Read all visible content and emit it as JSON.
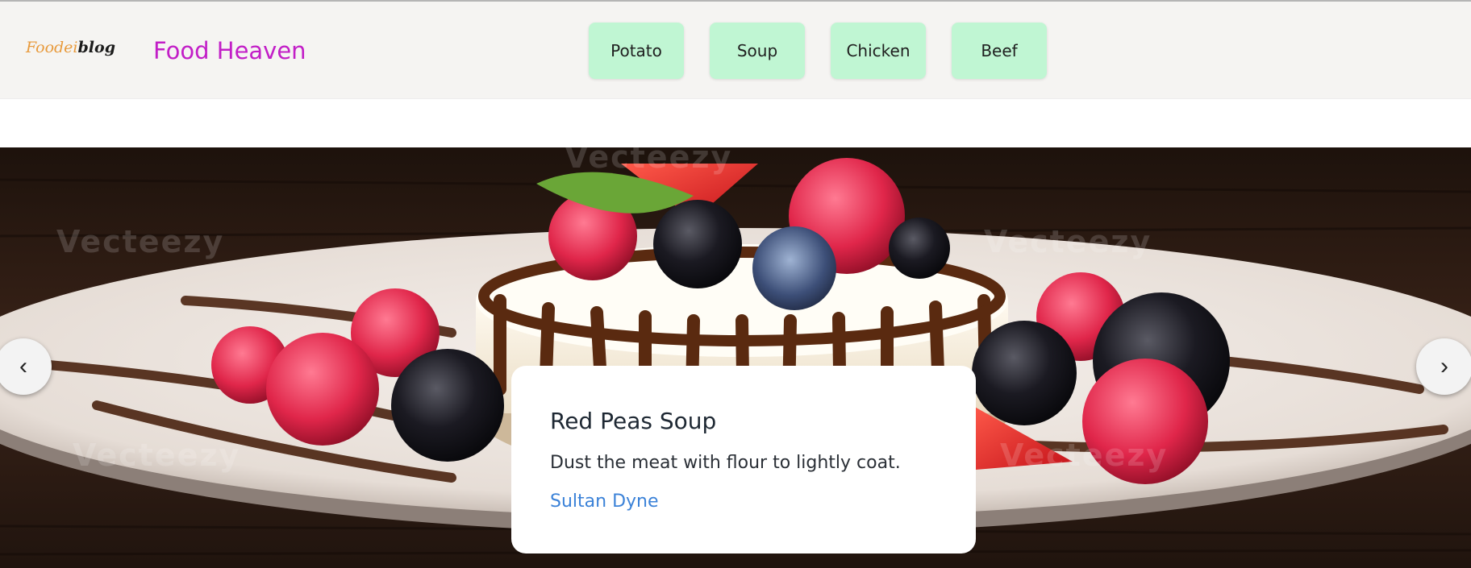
{
  "header": {
    "logo": {
      "part1": "Foodei",
      "part2": "blog"
    },
    "brand": "Food Heaven",
    "categories": [
      {
        "label": "Potato"
      },
      {
        "label": "Soup"
      },
      {
        "label": "Chicken"
      },
      {
        "label": "Beef"
      }
    ]
  },
  "carousel": {
    "prev_icon": "‹",
    "next_icon": "›",
    "watermark": "Vecteezy",
    "caption": {
      "title": "Red Peas Soup",
      "text": "Dust the meat with flour to lightly coat.",
      "author": "Sultan Dyne"
    }
  },
  "colors": {
    "brand": "#c21ec7",
    "category_bg": "#c0f6d3",
    "link": "#3b82d8",
    "nav_bg": "#f5f4f2"
  }
}
